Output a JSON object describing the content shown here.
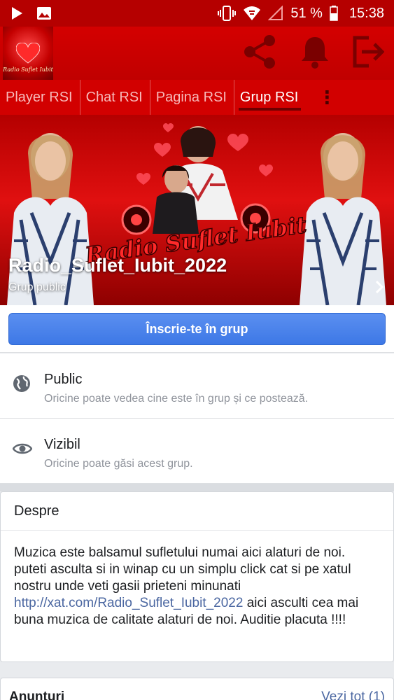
{
  "status_bar": {
    "battery": "51 %",
    "time": "15:38",
    "icons": [
      "play-icon",
      "image-icon",
      "vibrate-icon",
      "wifi-icon",
      "signal-icon",
      "battery-icon"
    ]
  },
  "header": {
    "logo_text": "Radio Suflet Iubit",
    "icons": [
      "share-icon",
      "bell-icon",
      "exit-icon"
    ]
  },
  "tabs": [
    {
      "label": "Player RSI"
    },
    {
      "label": "Chat RSI"
    },
    {
      "label": "Pagina RSI"
    },
    {
      "label": "Grup RSI"
    }
  ],
  "cover": {
    "title": "Radio_Suflet_Iubit_2022",
    "subtitle": "Grup public",
    "logo_text": "Radio Suflet Iubit"
  },
  "join_button": "Înscrie-te în grup",
  "privacy": [
    {
      "title": "Public",
      "desc": "Oricine poate vedea cine este în grup și ce postează.",
      "icon": "globe-icon"
    },
    {
      "title": "Vizibil",
      "desc": "Oricine poate găsi acest grup.",
      "icon": "eye-icon"
    }
  ],
  "about": {
    "title": "Despre",
    "text_before": "Muzica este balsamul sufletului numai aici alaturi de noi. puteti asculta si in winap cu un simplu click cat si pe xatul nostru unde veti gasii prieteni minunati ",
    "link": "http://xat.com/Radio_Suflet_Iubit_2022",
    "text_after": " aici asculti cea mai buna muzica de calitate alaturi de noi. Auditie placuta !!!!"
  },
  "announcements": {
    "title": "Anunturi",
    "see_all": "Vezi tot (1)"
  },
  "colors": {
    "header_red": "#d20000",
    "status_red": "#b50000",
    "join_blue": "#3d78e6",
    "link_blue": "#4b67a1"
  }
}
